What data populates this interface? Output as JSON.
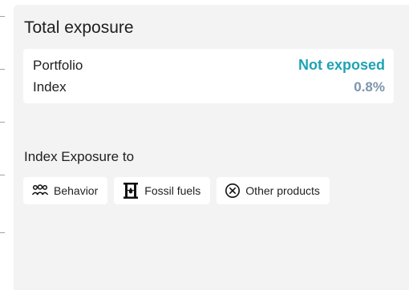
{
  "panel": {
    "title": "Total exposure"
  },
  "summary": {
    "rows": [
      {
        "label": "Portfolio",
        "value": "Not exposed",
        "value_color": "#1fa3b4"
      },
      {
        "label": "Index",
        "value": "0.8%",
        "value_color": "#7b95ad"
      }
    ]
  },
  "exposure": {
    "label": "Index Exposure to",
    "chips": [
      {
        "label": "Behavior",
        "icon": "people-group-icon"
      },
      {
        "label": "Fossil fuels",
        "icon": "oil-barrel-icon"
      },
      {
        "label": "Other products",
        "icon": "circle-x-icon"
      }
    ]
  }
}
